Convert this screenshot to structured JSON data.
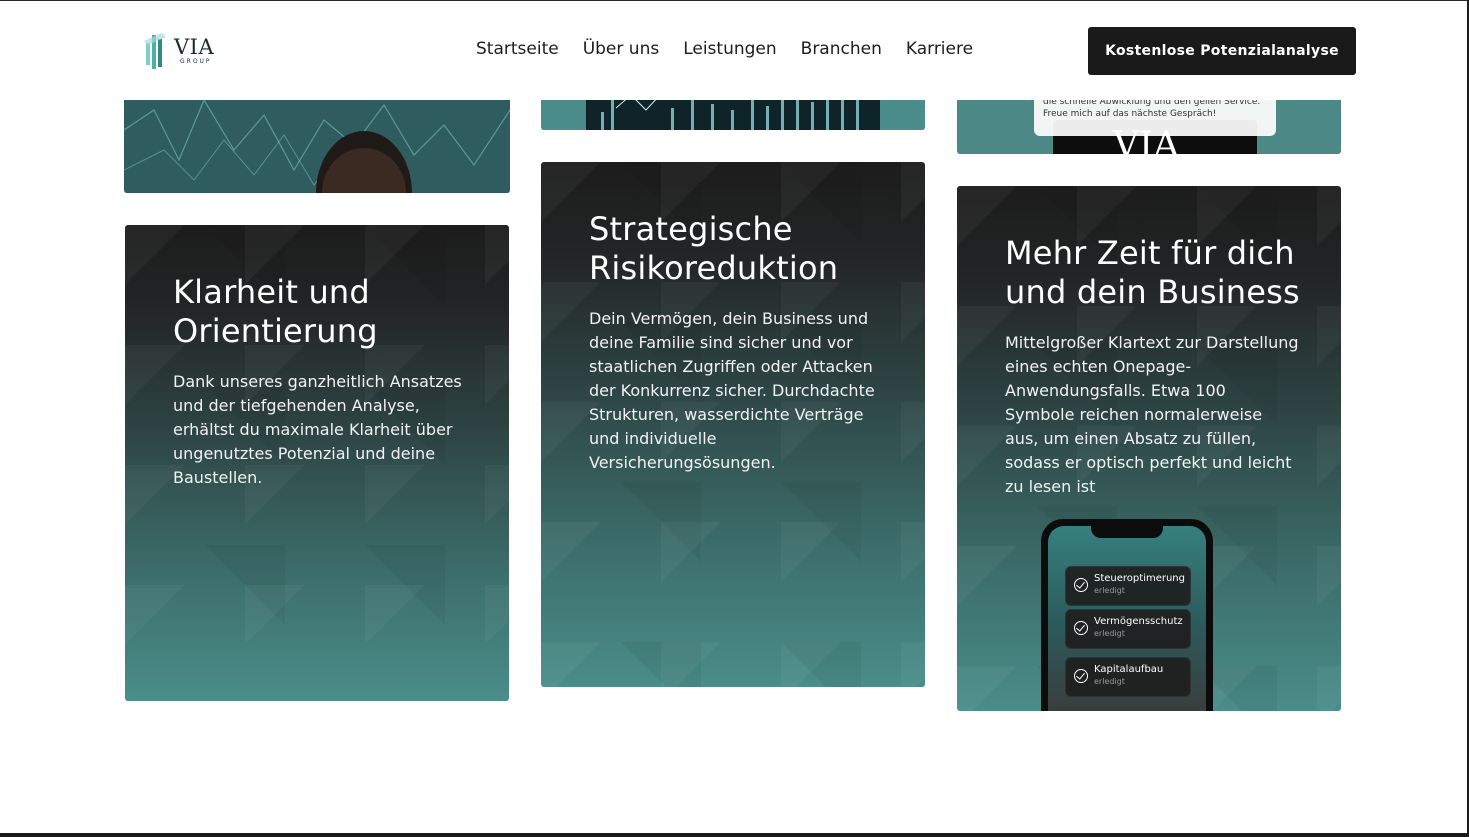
{
  "header": {
    "logo_text": "VIA",
    "logo_sub": "GROUP",
    "nav": [
      "Startseite",
      "Über uns",
      "Leistungen",
      "Branchen",
      "Karriere"
    ],
    "cta_label": "Kostenlose Potenzialanalyse"
  },
  "testimonial_snippet": {
    "line1": "die schnelle Abwicklung und den geilen Service.",
    "line2": "Freue mich auf das nächste Gespräch!",
    "brand_text": "VIA"
  },
  "cards": [
    {
      "title": "Klarheit und Orientierung",
      "text": "Dank unseres ganzheitlich Ansatzes und der tiefgehenden Analyse, erhältst du maximale Klarheit über ungenutztes Potenzial und deine Baustellen."
    },
    {
      "title": "Strategische Risikoreduktion",
      "text": "Dein Vermögen, dein Business und deine Familie sind sicher und vor staatlichen Zugriffen oder Attacken der Konkurrenz sicher. Durchdachte Strukturen, wasserdichte Verträge und individuelle Versicherungsösungen."
    },
    {
      "title": "Mehr Zeit für dich und dein Business",
      "text": "Mittelgroßer Klartext zur Darstellung eines echten Onepage-Anwendungsfalls. Etwa 100 Symbole reichen normalerweise aus, um einen Absatz zu füllen, sodass er optisch perfekt und leicht zu lesen ist"
    }
  ],
  "phone_tasks": [
    {
      "name": "Steueroptimerung",
      "status": "erledigt"
    },
    {
      "name": "Vermögensschutz",
      "status": "erledigt"
    },
    {
      "name": "Kapitalaufbau",
      "status": "erledigt"
    }
  ],
  "colors": {
    "accent_teal": "#4a8d89",
    "dark": "#1a1a1a"
  }
}
